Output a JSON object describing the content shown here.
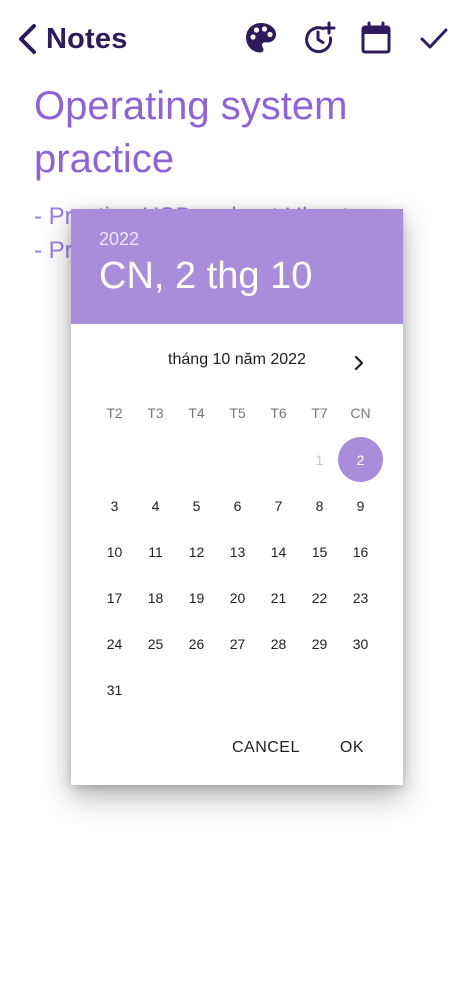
{
  "appbar": {
    "back_label": "Notes",
    "icons": [
      "back-chevron-icon",
      "palette-icon",
      "reminder-add-icon",
      "calendar-icon",
      "check-icon"
    ]
  },
  "note": {
    "title": "Operating system practice",
    "body_line1": "- Practice USB on boot Ubuntu.",
    "body_line2": "- Practice"
  },
  "datepicker": {
    "header_year": "2022",
    "header_date": "CN, 2 thg 10",
    "month_label": "tháng 10 năm 2022",
    "weekdays": [
      "T2",
      "T3",
      "T4",
      "T5",
      "T6",
      "T7",
      "CN"
    ],
    "weeks": [
      [
        "",
        "",
        "",
        "",
        "",
        "1",
        "2"
      ],
      [
        "3",
        "4",
        "5",
        "6",
        "7",
        "8",
        "9"
      ],
      [
        "10",
        "11",
        "12",
        "13",
        "14",
        "15",
        "16"
      ],
      [
        "17",
        "18",
        "19",
        "20",
        "21",
        "22",
        "23"
      ],
      [
        "24",
        "25",
        "26",
        "27",
        "28",
        "29",
        "30"
      ],
      [
        "31",
        "",
        "",
        "",
        "",
        "",
        ""
      ]
    ],
    "selected_day": "2",
    "disabled_days": [
      "1"
    ],
    "cancel_label": "CANCEL",
    "ok_label": "OK"
  },
  "colors": {
    "accent": "#a88ddb",
    "title_dark": "#2e1a5c",
    "note_purple": "#8e63d6"
  }
}
